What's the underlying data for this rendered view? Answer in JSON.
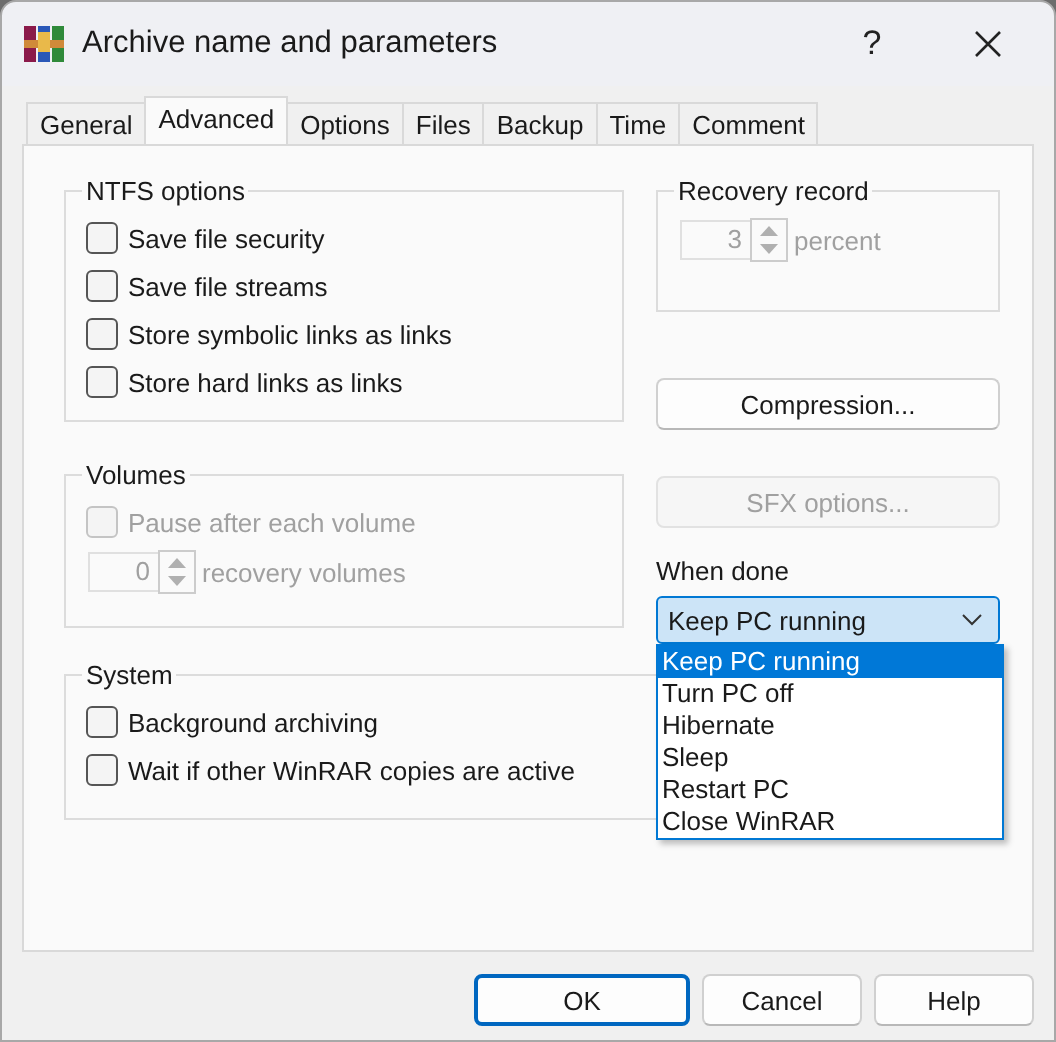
{
  "window": {
    "title": "Archive name and parameters",
    "help": "?"
  },
  "tabs": [
    {
      "label": "General",
      "selected": false
    },
    {
      "label": "Advanced",
      "selected": true
    },
    {
      "label": "Options",
      "selected": false
    },
    {
      "label": "Files",
      "selected": false
    },
    {
      "label": "Backup",
      "selected": false
    },
    {
      "label": "Time",
      "selected": false
    },
    {
      "label": "Comment",
      "selected": false
    }
  ],
  "ntfs_options": {
    "title": "NTFS options",
    "options": [
      {
        "label": "Save file security",
        "checked": false,
        "disabled": false
      },
      {
        "label": "Save file streams",
        "checked": false,
        "disabled": false
      },
      {
        "label": "Store symbolic links as links",
        "checked": false,
        "disabled": false
      },
      {
        "label": "Store hard links as links",
        "checked": false,
        "disabled": false
      }
    ]
  },
  "volumes": {
    "title": "Volumes",
    "pause": {
      "label": "Pause after each volume",
      "checked": false,
      "disabled": true
    },
    "recovery_volumes": {
      "value": "0",
      "unit": "recovery volumes",
      "disabled": true
    }
  },
  "system": {
    "title": "System",
    "options": [
      {
        "label": "Background archiving",
        "checked": false,
        "disabled": false
      },
      {
        "label": "Wait if other WinRAR copies are active",
        "checked": false,
        "disabled": false
      }
    ]
  },
  "recovery_record": {
    "title": "Recovery record",
    "value": "3",
    "unit": "percent",
    "disabled": true
  },
  "compression_button": {
    "label": "Compression...",
    "disabled": false
  },
  "sfx_button": {
    "label": "SFX options...",
    "disabled": true
  },
  "when_done": {
    "label": "When done",
    "value": "Keep PC running",
    "expanded": true,
    "options": [
      {
        "label": "Keep PC running",
        "selected": true
      },
      {
        "label": "Turn PC off",
        "selected": false
      },
      {
        "label": "Hibernate",
        "selected": false
      },
      {
        "label": "Sleep",
        "selected": false
      },
      {
        "label": "Restart PC",
        "selected": false
      },
      {
        "label": "Close WinRAR",
        "selected": false
      }
    ]
  },
  "buttons": [
    {
      "label": "OK",
      "default": true
    },
    {
      "label": "Cancel",
      "default": false
    },
    {
      "label": "Help",
      "default": false
    }
  ]
}
